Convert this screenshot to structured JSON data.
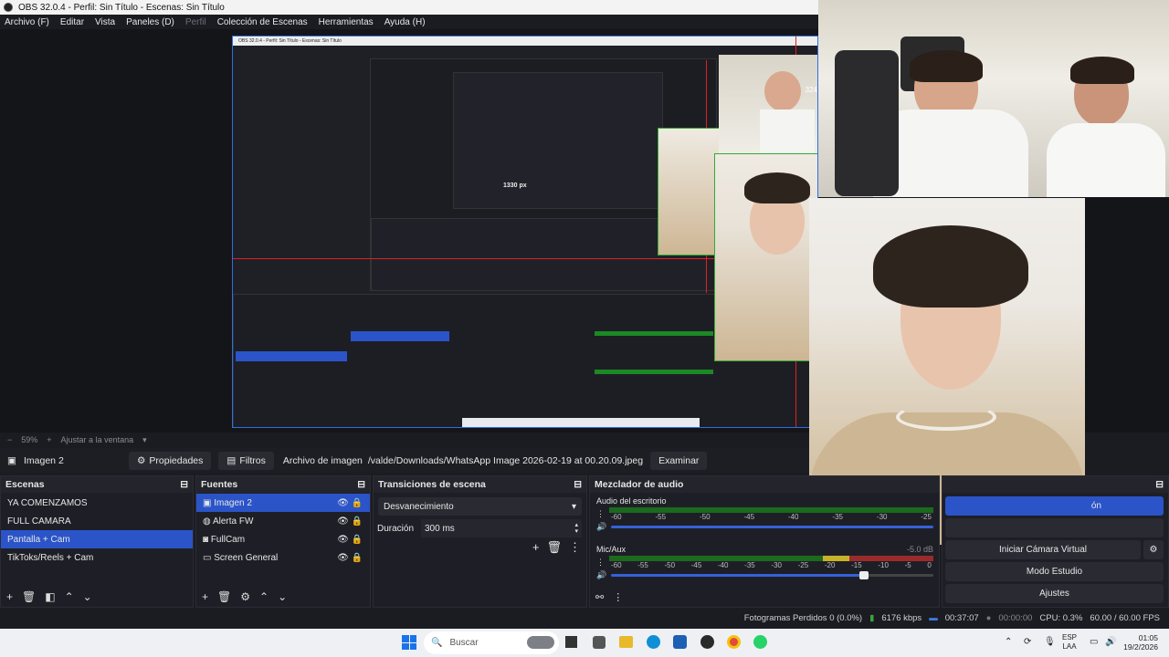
{
  "window": {
    "title": "OBS 32.0.4 - Perfil: Sin Título - Escenas: Sin Título"
  },
  "menu": [
    "Archivo (F)",
    "Editar",
    "Vista",
    "Paneles (D)",
    "Perfil",
    "Colección de Escenas",
    "Herramientas",
    "Ayuda (H)"
  ],
  "zoom": {
    "value": "59%",
    "fit_label": "Ajustar a la ventana"
  },
  "source_toolbar": {
    "source_name": "Imagen 2",
    "properties_label": "Propiedades",
    "filters_label": "Filtros",
    "file_label": "Archivo de imagen",
    "file_path": "/valde/Downloads/WhatsApp Image 2026-02-19 at 00.20.09.jpeg",
    "browse_label": "Examinar"
  },
  "scenes": {
    "title": "Escenas",
    "items": [
      "YA COMENZAMOS",
      "FULL CAMARA",
      "Pantalla + Cam",
      "TikToks/Reels + Cam"
    ],
    "selected": "Pantalla + Cam"
  },
  "sources": {
    "title": "Fuentes",
    "items": [
      {
        "label": "Imagen 2",
        "icon": "image-icon"
      },
      {
        "label": "Alerta FW",
        "icon": "browser-icon"
      },
      {
        "label": "FullCam",
        "icon": "camera-icon"
      },
      {
        "label": "Screen General",
        "icon": "monitor-icon"
      }
    ]
  },
  "transitions": {
    "title": "Transiciones de escena",
    "type": "Desvanecimiento",
    "duration_label": "Duración",
    "duration_value": "300 ms"
  },
  "mixer": {
    "title": "Mezclador de audio",
    "channels": [
      {
        "name": "Audio del escritorio"
      },
      {
        "name": "Mic/Aux",
        "db": "-5.0 dB"
      }
    ],
    "scale": [
      "-60",
      "-55",
      "-50",
      "-45",
      "-40",
      "-35",
      "-30",
      "-25",
      "-20",
      "-15",
      "-10",
      "-5",
      "0"
    ]
  },
  "controls": {
    "partial_label": "ón",
    "virtual_cam": "Iniciar Cámara Virtual",
    "studio_mode": "Modo Estudio",
    "settings": "Ajustes"
  },
  "status": {
    "dropped": "Fotogramas Perdidos 0 (0.0%)",
    "bitrate": "6176 kbps",
    "live_time": "00:37:07",
    "rec_time": "00:00:00",
    "cpu": "CPU: 0.3%",
    "fps": "60.00 / 60.00 FPS"
  },
  "taskbar": {
    "search_placeholder": "Buscar",
    "lang_top": "ESP",
    "lang_bottom": "LAA",
    "time": "01:05",
    "date": "19/2/2026"
  },
  "nested": {
    "title": "OBS 32.0.4 - Perfil: Sin Título - Escenas: Sin Título",
    "px_label": "1330 px",
    "cam_label": "324"
  },
  "colors": {
    "accent": "#2b54c8",
    "meter_green": "#1b8a24",
    "guide_red": "#e02020"
  }
}
